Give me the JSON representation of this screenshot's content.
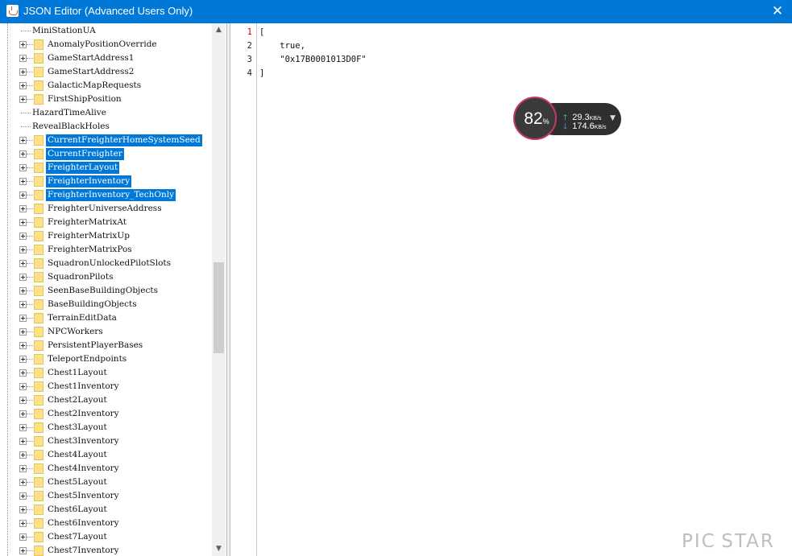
{
  "window": {
    "title": "JSON Editor (Advanced Users Only)",
    "icon": "java-cup-icon",
    "close_icon": "close-icon"
  },
  "tree": {
    "items": [
      {
        "label": "MiniStationUA",
        "type": "leaf",
        "selected": false
      },
      {
        "label": "AnomalyPositionOverride",
        "type": "folder",
        "selected": false
      },
      {
        "label": "GameStartAddress1",
        "type": "folder",
        "selected": false
      },
      {
        "label": "GameStartAddress2",
        "type": "folder",
        "selected": false
      },
      {
        "label": "GalacticMapRequests",
        "type": "folder",
        "selected": false
      },
      {
        "label": "FirstShipPosition",
        "type": "folder",
        "selected": false
      },
      {
        "label": "HazardTimeAlive",
        "type": "leaf",
        "selected": false
      },
      {
        "label": "RevealBlackHoles",
        "type": "leaf",
        "selected": false
      },
      {
        "label": "CurrentFreighterHomeSystemSeed",
        "type": "folder",
        "selected": true
      },
      {
        "label": "CurrentFreighter",
        "type": "folder",
        "selected": true
      },
      {
        "label": "FreighterLayout",
        "type": "folder",
        "selected": true
      },
      {
        "label": "FreighterInventory",
        "type": "folder",
        "selected": true
      },
      {
        "label": "FreighterInventory_TechOnly",
        "type": "folder",
        "selected": true
      },
      {
        "label": "FreighterUniverseAddress",
        "type": "folder",
        "selected": false
      },
      {
        "label": "FreighterMatrixAt",
        "type": "folder",
        "selected": false
      },
      {
        "label": "FreighterMatrixUp",
        "type": "folder",
        "selected": false
      },
      {
        "label": "FreighterMatrixPos",
        "type": "folder",
        "selected": false
      },
      {
        "label": "SquadronUnlockedPilotSlots",
        "type": "folder",
        "selected": false
      },
      {
        "label": "SquadronPilots",
        "type": "folder",
        "selected": false
      },
      {
        "label": "SeenBaseBuildingObjects",
        "type": "folder",
        "selected": false
      },
      {
        "label": "BaseBuildingObjects",
        "type": "folder",
        "selected": false
      },
      {
        "label": "TerrainEditData",
        "type": "folder",
        "selected": false
      },
      {
        "label": "NPCWorkers",
        "type": "folder",
        "selected": false
      },
      {
        "label": "PersistentPlayerBases",
        "type": "folder",
        "selected": false
      },
      {
        "label": "TeleportEndpoints",
        "type": "folder",
        "selected": false
      },
      {
        "label": "Chest1Layout",
        "type": "folder",
        "selected": false
      },
      {
        "label": "Chest1Inventory",
        "type": "folder",
        "selected": false
      },
      {
        "label": "Chest2Layout",
        "type": "folder",
        "selected": false
      },
      {
        "label": "Chest2Inventory",
        "type": "folder",
        "selected": false
      },
      {
        "label": "Chest3Layout",
        "type": "folder",
        "selected": false
      },
      {
        "label": "Chest3Inventory",
        "type": "folder",
        "selected": false
      },
      {
        "label": "Chest4Layout",
        "type": "folder",
        "selected": false
      },
      {
        "label": "Chest4Inventory",
        "type": "folder",
        "selected": false
      },
      {
        "label": "Chest5Layout",
        "type": "folder",
        "selected": false
      },
      {
        "label": "Chest5Inventory",
        "type": "folder",
        "selected": false
      },
      {
        "label": "Chest6Layout",
        "type": "folder",
        "selected": false
      },
      {
        "label": "Chest6Inventory",
        "type": "folder",
        "selected": false
      },
      {
        "label": "Chest7Layout",
        "type": "folder",
        "selected": false
      },
      {
        "label": "Chest7Inventory",
        "type": "folder",
        "selected": false
      }
    ],
    "scroll_up_icon": "▲",
    "scroll_down_icon": "▼"
  },
  "editor": {
    "line_numbers": [
      "1",
      "2",
      "3",
      "4"
    ],
    "active_line": "1",
    "lines": [
      "[",
      "    true,",
      "    \"0x17B0001013D0F\"",
      "]"
    ]
  },
  "network_widget": {
    "percent": "82",
    "percent_unit": "%",
    "upload": "29.3",
    "download": "174.6",
    "unit": "KB/s",
    "ring_color": "#c23a6b"
  },
  "watermark": {
    "text": "PIC STAR"
  },
  "colors": {
    "titlebar": "#0078d7",
    "selection": "#0078d7",
    "folder": "#ffe08a",
    "active_line_number": "#dd0000"
  }
}
